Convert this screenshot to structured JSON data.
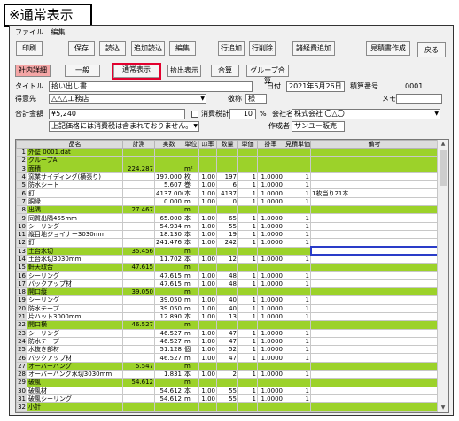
{
  "caption": "※通常表示",
  "menu": [
    "ファイル",
    "編集"
  ],
  "toolbar": {
    "print": "印刷",
    "save": "保存",
    "load": "読込",
    "add_load": "追加読込",
    "edit": "編集",
    "row_add": "行追加",
    "row_delete": "行削除",
    "misc_cost": "諸経費追加",
    "quote_create": "見積書作成",
    "back": "戻る"
  },
  "views": {
    "company_detail": "社内詳細",
    "general": "一般",
    "normal": "通常表示",
    "extract": "拾出表示",
    "total": "合算",
    "group_total": "グループ合算"
  },
  "form": {
    "title_label": "タイトル",
    "title_value": "拾い出し書",
    "date_label": "日付",
    "date_value": "2021年5月26日",
    "quote_no_label": "積算番号",
    "quote_no_value": "0001",
    "client_label": "得意先",
    "client_value": "△△△工務店",
    "honorific_label": "敬称",
    "honorific_value": "様",
    "memo_label": "メモ",
    "memo_value": "",
    "total_label": "合計金額",
    "total_value": "¥5,240",
    "tax_label": "消費税計算",
    "tax_value": "10",
    "tax_unit": "%",
    "company_label": "会社名",
    "company_value": "株式会社 〇△〇",
    "author_label": "作成者",
    "author_value": "サンユー販売",
    "note_value": "上記価格には消費税は含まれておりません。"
  },
  "grid": {
    "headers": [
      "",
      "品名",
      "計測",
      "実数",
      "単位",
      "ﾛｽ率",
      "数量",
      "単価",
      "掛率",
      "見積単価",
      "備考"
    ],
    "rows": [
      {
        "n": "1",
        "type": "group",
        "name": "外壁  0001.dat",
        "meas": "",
        "real": "",
        "unit": "",
        "loss": "",
        "qty": "",
        "price": "",
        "rate": "",
        "quote": "",
        "note": ""
      },
      {
        "n": "2",
        "type": "group",
        "name": "グループA",
        "meas": "",
        "real": "",
        "unit": "",
        "loss": "",
        "qty": "",
        "price": "",
        "rate": "",
        "quote": "",
        "note": ""
      },
      {
        "n": "3",
        "type": "sect",
        "name": "面積",
        "meas": "224.287",
        "real": "",
        "unit": "m²",
        "loss": "",
        "qty": "",
        "price": "",
        "rate": "",
        "quote": "",
        "note": ""
      },
      {
        "n": "4",
        "type": "item",
        "name": "窯業サイディング(横張り)",
        "meas": "",
        "real": "197.000",
        "unit": "枚",
        "loss": "1.00",
        "qty": "197",
        "price": "1",
        "rate": "1.0000",
        "quote": "1",
        "note": ""
      },
      {
        "n": "5",
        "type": "item",
        "name": "防水シート",
        "meas": "",
        "real": "5.607",
        "unit": "巻",
        "loss": "1.00",
        "qty": "6",
        "price": "1",
        "rate": "1.0000",
        "quote": "1",
        "note": ""
      },
      {
        "n": "6",
        "type": "item",
        "name": "釘",
        "meas": "",
        "real": "4137.000",
        "unit": "本",
        "loss": "1.00",
        "qty": "4137",
        "price": "1",
        "rate": "1.0000",
        "quote": "1",
        "note": "1枚当り21本"
      },
      {
        "n": "7",
        "type": "item",
        "name": "胴縁",
        "meas": "",
        "real": "0.000",
        "unit": "m",
        "loss": "1.00",
        "qty": "0",
        "price": "1",
        "rate": "1.0000",
        "quote": "1",
        "note": ""
      },
      {
        "n": "8",
        "type": "sect",
        "name": "出隅",
        "meas": "27.467",
        "real": "",
        "unit": "m",
        "loss": "",
        "qty": "",
        "price": "",
        "rate": "",
        "quote": "",
        "note": ""
      },
      {
        "n": "9",
        "type": "item",
        "name": "同質出隅455mm",
        "meas": "",
        "real": "65.000",
        "unit": "本",
        "loss": "1.00",
        "qty": "65",
        "price": "1",
        "rate": "1.0000",
        "quote": "1",
        "note": ""
      },
      {
        "n": "10",
        "type": "item",
        "name": "シーリング",
        "meas": "",
        "real": "54.934",
        "unit": "m",
        "loss": "1.00",
        "qty": "55",
        "price": "1",
        "rate": "1.0000",
        "quote": "1",
        "note": ""
      },
      {
        "n": "11",
        "type": "item",
        "name": "縦目地ジョイナー3030mm",
        "meas": "",
        "real": "18.130",
        "unit": "本",
        "loss": "1.00",
        "qty": "19",
        "price": "1",
        "rate": "1.0000",
        "quote": "1",
        "note": ""
      },
      {
        "n": "12",
        "type": "item",
        "name": "釘",
        "meas": "",
        "real": "241.476",
        "unit": "本",
        "loss": "1.00",
        "qty": "242",
        "price": "1",
        "rate": "1.0000",
        "quote": "1",
        "note": ""
      },
      {
        "n": "13",
        "type": "sect",
        "name": "土台水切",
        "meas": "35.456",
        "real": "",
        "unit": "m",
        "loss": "",
        "qty": "",
        "price": "",
        "rate": "",
        "quote": "",
        "note": "",
        "sel": true
      },
      {
        "n": "14",
        "type": "item",
        "name": "土台水切3030mm",
        "meas": "",
        "real": "11.702",
        "unit": "本",
        "loss": "1.00",
        "qty": "12",
        "price": "1",
        "rate": "1.0000",
        "quote": "1",
        "note": ""
      },
      {
        "n": "15",
        "type": "sect",
        "name": "軒天取合",
        "meas": "47.615",
        "real": "",
        "unit": "m",
        "loss": "",
        "qty": "",
        "price": "",
        "rate": "",
        "quote": "",
        "note": ""
      },
      {
        "n": "16",
        "type": "item",
        "name": "シーリング",
        "meas": "",
        "real": "47.615",
        "unit": "m",
        "loss": "1.00",
        "qty": "48",
        "price": "1",
        "rate": "1.0000",
        "quote": "1",
        "note": ""
      },
      {
        "n": "17",
        "type": "item",
        "name": "バックアップ材",
        "meas": "",
        "real": "47.615",
        "unit": "m",
        "loss": "1.00",
        "qty": "48",
        "price": "1",
        "rate": "1.0000",
        "quote": "1",
        "note": ""
      },
      {
        "n": "18",
        "type": "sect",
        "name": "開口縦",
        "meas": "39.050",
        "real": "",
        "unit": "m",
        "loss": "",
        "qty": "",
        "price": "",
        "rate": "",
        "quote": "",
        "note": ""
      },
      {
        "n": "19",
        "type": "item",
        "name": "シーリング",
        "meas": "",
        "real": "39.050",
        "unit": "m",
        "loss": "1.00",
        "qty": "40",
        "price": "1",
        "rate": "1.0000",
        "quote": "1",
        "note": ""
      },
      {
        "n": "20",
        "type": "item",
        "name": "防水テープ",
        "meas": "",
        "real": "39.050",
        "unit": "m",
        "loss": "1.00",
        "qty": "40",
        "price": "1",
        "rate": "1.0000",
        "quote": "1",
        "note": ""
      },
      {
        "n": "21",
        "type": "item",
        "name": "片ハット3000mm",
        "meas": "",
        "real": "12.890",
        "unit": "本",
        "loss": "1.00",
        "qty": "13",
        "price": "1",
        "rate": "1.0000",
        "quote": "1",
        "note": ""
      },
      {
        "n": "22",
        "type": "sect",
        "name": "開口横",
        "meas": "46.527",
        "real": "",
        "unit": "m",
        "loss": "",
        "qty": "",
        "price": "",
        "rate": "",
        "quote": "",
        "note": ""
      },
      {
        "n": "23",
        "type": "item",
        "name": "シーリング",
        "meas": "",
        "real": "46.527",
        "unit": "m",
        "loss": "1.00",
        "qty": "47",
        "price": "1",
        "rate": "1.0000",
        "quote": "1",
        "note": ""
      },
      {
        "n": "24",
        "type": "item",
        "name": "防水テープ",
        "meas": "",
        "real": "46.527",
        "unit": "m",
        "loss": "1.00",
        "qty": "47",
        "price": "1",
        "rate": "1.0000",
        "quote": "1",
        "note": ""
      },
      {
        "n": "25",
        "type": "item",
        "name": "水抜き部材",
        "meas": "",
        "real": "51.128",
        "unit": "個",
        "loss": "1.00",
        "qty": "52",
        "price": "1",
        "rate": "1.0000",
        "quote": "1",
        "note": ""
      },
      {
        "n": "26",
        "type": "item",
        "name": "バックアップ材",
        "meas": "",
        "real": "46.527",
        "unit": "m",
        "loss": "1.00",
        "qty": "47",
        "price": "1",
        "rate": "1.0000",
        "quote": "1",
        "note": ""
      },
      {
        "n": "27",
        "type": "sect",
        "name": "オーバーハング",
        "meas": "5.547",
        "real": "",
        "unit": "m",
        "loss": "",
        "qty": "",
        "price": "",
        "rate": "",
        "quote": "",
        "note": ""
      },
      {
        "n": "28",
        "type": "item",
        "name": "オーバーハング水切3030mm",
        "meas": "",
        "real": "1.831",
        "unit": "本",
        "loss": "1.00",
        "qty": "2",
        "price": "1",
        "rate": "1.0000",
        "quote": "1",
        "note": ""
      },
      {
        "n": "29",
        "type": "sect",
        "name": "破風",
        "meas": "54.612",
        "real": "",
        "unit": "m",
        "loss": "",
        "qty": "",
        "price": "",
        "rate": "",
        "quote": "",
        "note": ""
      },
      {
        "n": "30",
        "type": "item",
        "name": "破風材",
        "meas": "",
        "real": "54.612",
        "unit": "本",
        "loss": "1.00",
        "qty": "55",
        "price": "1",
        "rate": "1.0000",
        "quote": "1",
        "note": ""
      },
      {
        "n": "31",
        "type": "item",
        "name": "破風シーリング",
        "meas": "",
        "real": "54.612",
        "unit": "m",
        "loss": "1.00",
        "qty": "55",
        "price": "1",
        "rate": "1.0000",
        "quote": "1",
        "note": ""
      },
      {
        "n": "32",
        "type": "sect",
        "name": "小計",
        "meas": "",
        "real": "",
        "unit": "",
        "loss": "",
        "qty": "",
        "price": "",
        "rate": "",
        "quote": "",
        "note": ""
      }
    ]
  }
}
